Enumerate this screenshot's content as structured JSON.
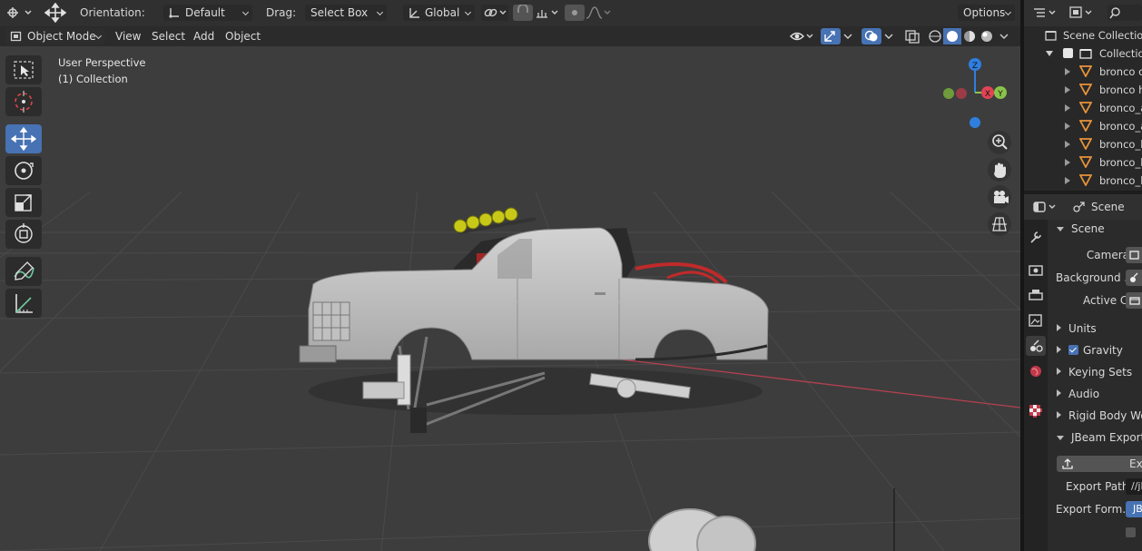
{
  "header": {
    "orientation_label": "Orientation:",
    "orientation_value": "Default",
    "drag_label": "Drag:",
    "drag_value": "Select Box",
    "transform_space": "Global",
    "options_label": "Options"
  },
  "mode_bar": {
    "mode": "Object Mode",
    "menus": [
      "View",
      "Select",
      "Add",
      "Object"
    ]
  },
  "viewport": {
    "perspective": "User Perspective",
    "collection": "(1) Collection",
    "gizmo_axes": [
      "Z",
      "X",
      "Y"
    ]
  },
  "toolbar": {
    "tools": [
      "select-box",
      "cursor",
      "move",
      "rotate",
      "scale",
      "transform",
      "annotate",
      "measure"
    ],
    "active_tool": "move"
  },
  "outliner": {
    "root": "Scene Collection",
    "collection": "Collection",
    "objects": [
      "bronco ch",
      "bronco ho",
      "bronco_a",
      "bronco_a",
      "bronco_b",
      "bronco_b",
      "bronco_b"
    ]
  },
  "properties": {
    "context": "Scene",
    "panel_title": "Scene",
    "fields": [
      {
        "label": "Camera"
      },
      {
        "label": "Background ..."
      },
      {
        "label": "Active Clip"
      }
    ],
    "panels": [
      {
        "label": "Units",
        "checkbox": false
      },
      {
        "label": "Gravity",
        "checkbox": true
      },
      {
        "label": "Keying Sets",
        "checkbox": false
      },
      {
        "label": "Audio",
        "checkbox": false
      },
      {
        "label": "Rigid Body Wo",
        "checkbox": false
      }
    ],
    "jbeam": {
      "title": "JBeam Exporte",
      "export_button": "Expo",
      "export_path_label": "Export Path",
      "export_path_value": "//jl",
      "export_format_label": "Export Form...",
      "export_format_value": "JB"
    }
  },
  "colors": {
    "accent": "#4772b3",
    "axis_x": "#e04455",
    "axis_y": "#8bc34a",
    "axis_z": "#2f7fe0",
    "object_icon": "#e8943a"
  }
}
